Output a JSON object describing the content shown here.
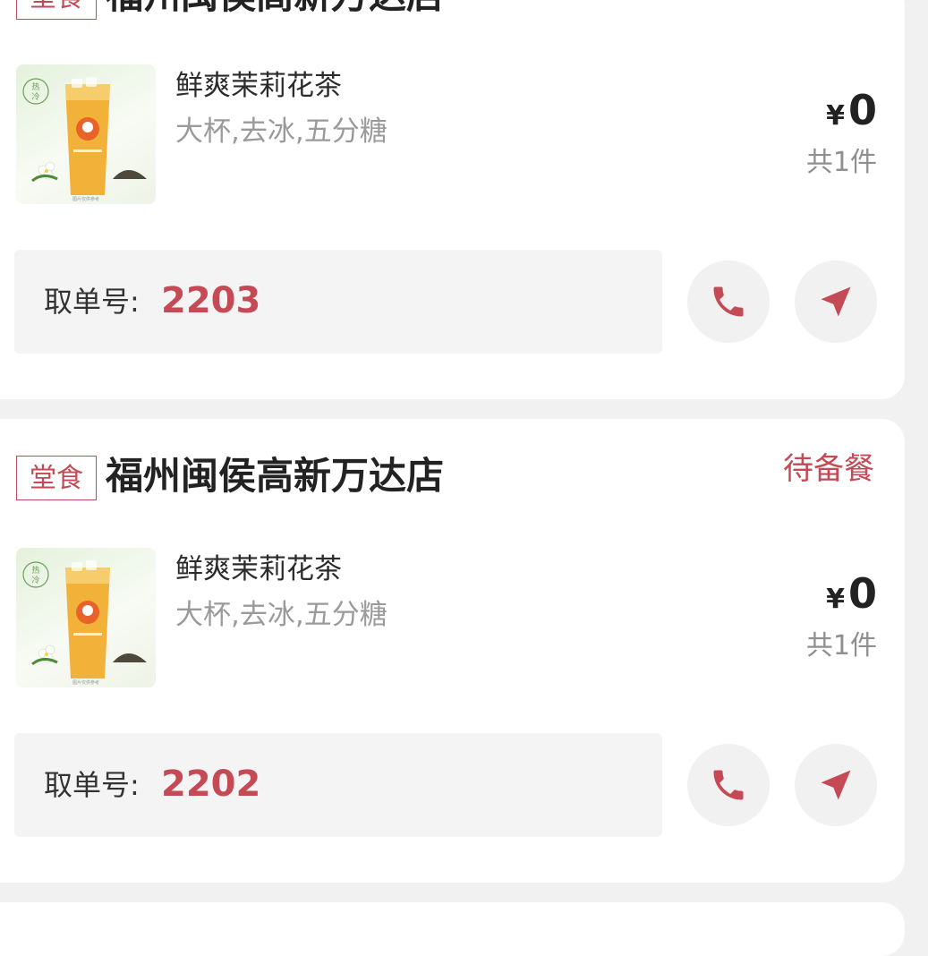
{
  "accent_color": "#c44a55",
  "orders": [
    {
      "tag": "堂食",
      "store": "福州闽侯高新万达店",
      "status": "",
      "product": {
        "name": "鲜爽茉莉花茶",
        "spec": "大杯,去冰,五分糖",
        "image": "jasmine-tea-drink"
      },
      "price": {
        "currency": "¥",
        "amount": "0"
      },
      "count": "共1件",
      "pickup": {
        "label": "取单号:",
        "code": "2203"
      },
      "actions": {
        "call_icon": "phone-icon",
        "nav_icon": "navigation-arrow-icon"
      }
    },
    {
      "tag": "堂食",
      "store": "福州闽侯高新万达店",
      "status": "待备餐",
      "product": {
        "name": "鲜爽茉莉花茶",
        "spec": "大杯,去冰,五分糖",
        "image": "jasmine-tea-drink"
      },
      "price": {
        "currency": "¥",
        "amount": "0"
      },
      "count": "共1件",
      "pickup": {
        "label": "取单号:",
        "code": "2202"
      },
      "actions": {
        "call_icon": "phone-icon",
        "nav_icon": "navigation-arrow-icon"
      }
    }
  ]
}
